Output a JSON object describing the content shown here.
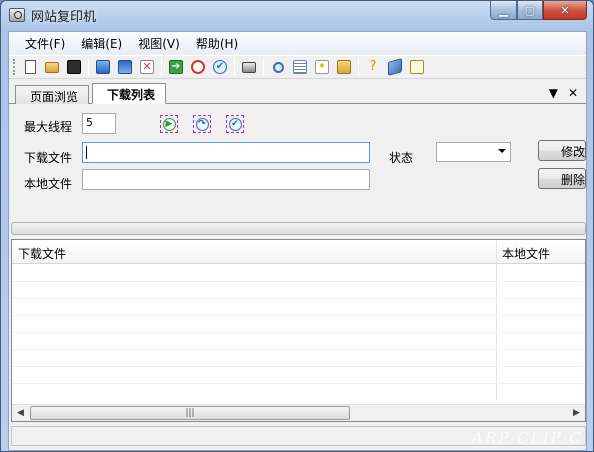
{
  "window": {
    "title": "网站复印机"
  },
  "menu": [
    "文件(F)",
    "编辑(E)",
    "视图(V)",
    "帮助(H)"
  ],
  "toolbar": {
    "icons": [
      "new-file-icon",
      "open-folder-icon",
      "save-icon",
      "download-icon",
      "upload-icon",
      "delete-icon",
      "go-icon",
      "stop-icon",
      "check-icon",
      "camera-icon",
      "search-icon",
      "list-icon",
      "new-star-icon",
      "find-icon",
      "help-icon",
      "book-icon",
      "edit-icon"
    ]
  },
  "tabs": [
    {
      "label": "页面浏览",
      "active": false
    },
    {
      "label": "下载列表",
      "active": true
    }
  ],
  "tab_controls": {
    "menu": "▼",
    "close": "✕"
  },
  "form": {
    "max_threads_label": "最大线程",
    "max_threads_value": "5",
    "download_file_label": "下载文件",
    "download_file_value": "",
    "local_file_label": "本地文件",
    "local_file_value": "",
    "status_label": "状态",
    "status_value": "",
    "modify_button": "修改",
    "delete_button": "删除"
  },
  "list": {
    "columns": [
      "下载文件",
      "本地文件"
    ],
    "rows": []
  },
  "scroll": {
    "left": "◀",
    "right": "▶",
    "thumb": "|||"
  },
  "watermark": "ARP·CLIP·C"
}
